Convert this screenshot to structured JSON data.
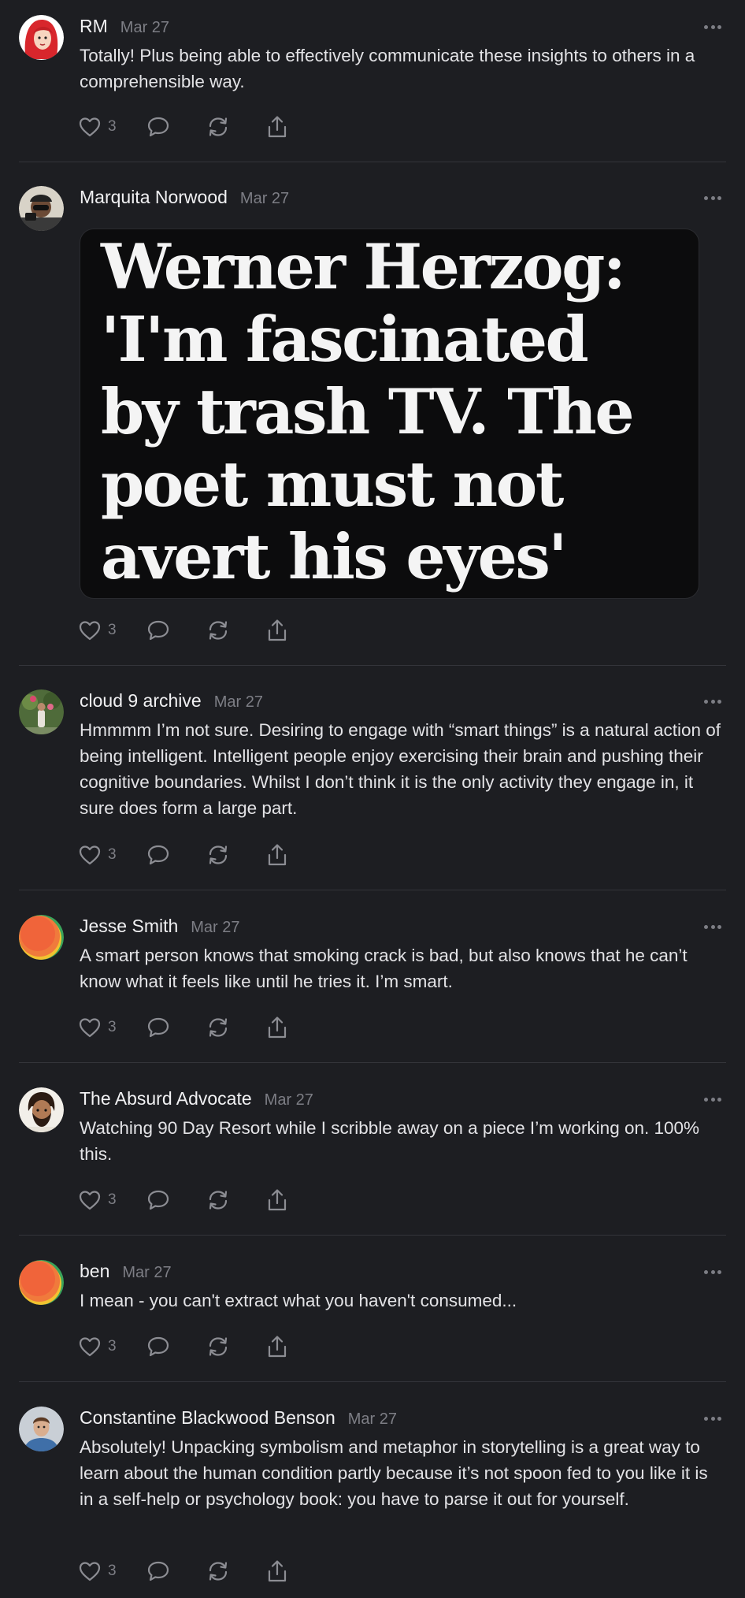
{
  "colors": {
    "background": "#1d1e22",
    "text": "#e9e9ec",
    "muted": "#7d7e85",
    "separator": "#33343a"
  },
  "icons": [
    "heart-icon",
    "comment-icon",
    "repost-icon",
    "share-icon",
    "more-icon"
  ],
  "posts": [
    {
      "author": "RM",
      "date": "Mar 27",
      "avatar": "red-haired-cartoon-avatar",
      "text": "Totally! Plus being able to effectively communicate these insights to others in a comprehensible way.",
      "likes": "3"
    },
    {
      "author": "Marquita Norwood",
      "date": "Mar 27",
      "avatar": "photo-avatar",
      "text": "",
      "image_text": "Werner Herzog: 'I'm fascinated by trash TV. The poet must not avert his eyes'",
      "likes": "3"
    },
    {
      "author": "cloud 9 archive",
      "date": "Mar 27",
      "avatar": "garden-photo-avatar",
      "text": "Hmmmm I’m not sure. Desiring to engage with “smart things” is a natural action of being intelligent. Intelligent people enjoy exercising their brain and pushing their cognitive boundaries. Whilst I don’t think it is the only activity they engage in, it sure does form a large part.",
      "likes": "3"
    },
    {
      "author": "Jesse Smith",
      "date": "Mar 27",
      "avatar": "default-gradient-avatar",
      "text": "A smart person knows that smoking crack is bad, but also knows that he can’t know what it feels like until he tries it. I’m smart.",
      "likes": "3"
    },
    {
      "author": "The Absurd Advocate",
      "date": "Mar 27",
      "avatar": "bearded-man-avatar",
      "text": "Watching 90 Day Resort while I scribble away on a piece I’m working on. 100% this.",
      "likes": "3"
    },
    {
      "author": "ben",
      "date": "Mar 27",
      "avatar": "default-gradient-avatar",
      "text": "I mean - you can't extract what you haven't consumed...",
      "likes": "3"
    },
    {
      "author": "Constantine Blackwood Benson",
      "date": "Mar 27",
      "avatar": "portrait-photo-avatar",
      "text": "Absolutely! Unpacking symbolism and metaphor in storytelling is a great way to learn about the human condition partly because it’s not spoon fed to you like it is in a self-help or psychology book: you have to parse it out for yourself.",
      "likes": "3"
    }
  ]
}
